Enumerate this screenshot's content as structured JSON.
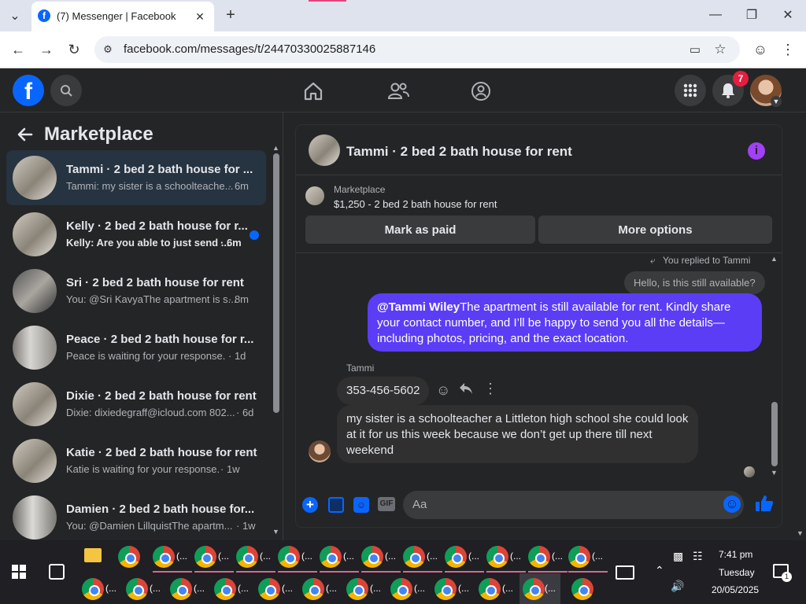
{
  "browser": {
    "tab_title": "(7) Messenger | Facebook",
    "url": "facebook.com/messages/t/24470330025887146"
  },
  "fb": {
    "notifications_count": "7"
  },
  "sidebar": {
    "title": "Marketplace",
    "conversations": [
      {
        "title": "Tammi · 2 bed 2 bath house for ...",
        "preview": "Tammi: my sister is a schoolteache...",
        "time": "· 6m",
        "selected": true
      },
      {
        "title": "Kelly · 2 bed 2 bath house for r...",
        "preview": "Kelly: Are you able to just send ...",
        "time": "· 6m",
        "unread": true
      },
      {
        "title": "Sri · 2 bed 2 bath house for rent",
        "preview": "You: @Sri KavyaThe apartment is s...",
        "time": "· 8m"
      },
      {
        "title": "Peace · 2 bed 2 bath house for r...",
        "preview": "Peace is waiting for your response.",
        "time": "· 1d"
      },
      {
        "title": "Dixie · 2 bed 2 bath house for rent",
        "preview": "Dixie: dixiedegraff@icloud.com 802...",
        "time": "· 6d"
      },
      {
        "title": "Katie · 2 bed 2 bath house for rent",
        "preview": "Katie is waiting for your response.",
        "time": "· 1w"
      },
      {
        "title": "Damien · 2 bed 2 bath house for...",
        "preview": "You: @Damien LillquistThe apartm...",
        "time": "· 1w"
      }
    ]
  },
  "chat": {
    "header_title": "Tammi · 2 bed 2 bath house for rent",
    "listing_source": "Marketplace",
    "listing_text": "$1,250 - 2 bed 2 bath house for rent",
    "mark_paid": "Mark as paid",
    "more_options": "More options",
    "replied_note": "You replied to Tammi",
    "quoted_msg": "Hello, is this still available?",
    "out_mention": "@Tammi Wiley",
    "out_text": "The apartment is still available for rent. Kindly share your contact number, and I’ll be happy to send you all the details—including photos, pricing, and the exact location.",
    "sender_name": "Tammi",
    "msg_phone": "353-456-5602",
    "msg_long": "my sister is a schoolteacher a Littleton high school she could look at it for us this week because we don’t get up there till next weekend",
    "input_placeholder": "Aa"
  },
  "taskbar": {
    "time": "7:41 pm",
    "day": "Tuesday",
    "date": "20/05/2025",
    "app_label": "(...",
    "notify_count": "1"
  },
  "colors": {
    "fb_blue": "#0866ff",
    "accent_purple": "#5b3df6",
    "badge_red": "#e41e3f"
  }
}
